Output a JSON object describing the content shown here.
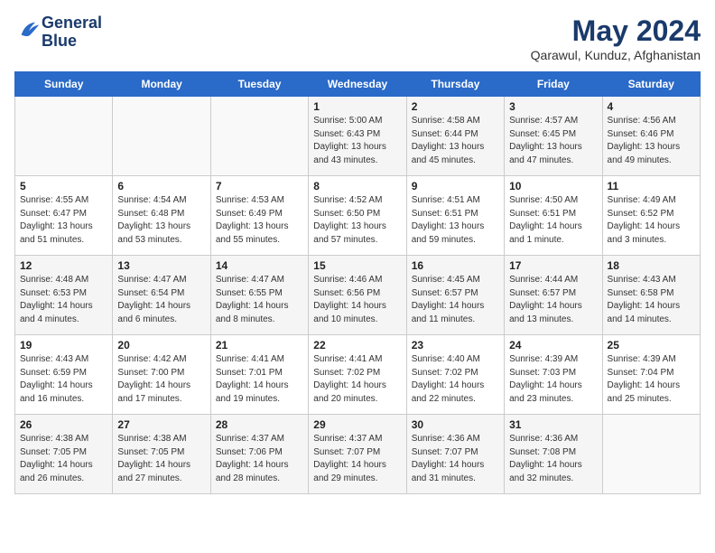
{
  "header": {
    "logo_line1": "General",
    "logo_line2": "Blue",
    "month": "May 2024",
    "location": "Qarawul, Kunduz, Afghanistan"
  },
  "weekdays": [
    "Sunday",
    "Monday",
    "Tuesday",
    "Wednesday",
    "Thursday",
    "Friday",
    "Saturday"
  ],
  "weeks": [
    [
      {
        "day": "",
        "info": ""
      },
      {
        "day": "",
        "info": ""
      },
      {
        "day": "",
        "info": ""
      },
      {
        "day": "1",
        "info": "Sunrise: 5:00 AM\nSunset: 6:43 PM\nDaylight: 13 hours\nand 43 minutes."
      },
      {
        "day": "2",
        "info": "Sunrise: 4:58 AM\nSunset: 6:44 PM\nDaylight: 13 hours\nand 45 minutes."
      },
      {
        "day": "3",
        "info": "Sunrise: 4:57 AM\nSunset: 6:45 PM\nDaylight: 13 hours\nand 47 minutes."
      },
      {
        "day": "4",
        "info": "Sunrise: 4:56 AM\nSunset: 6:46 PM\nDaylight: 13 hours\nand 49 minutes."
      }
    ],
    [
      {
        "day": "5",
        "info": "Sunrise: 4:55 AM\nSunset: 6:47 PM\nDaylight: 13 hours\nand 51 minutes."
      },
      {
        "day": "6",
        "info": "Sunrise: 4:54 AM\nSunset: 6:48 PM\nDaylight: 13 hours\nand 53 minutes."
      },
      {
        "day": "7",
        "info": "Sunrise: 4:53 AM\nSunset: 6:49 PM\nDaylight: 13 hours\nand 55 minutes."
      },
      {
        "day": "8",
        "info": "Sunrise: 4:52 AM\nSunset: 6:50 PM\nDaylight: 13 hours\nand 57 minutes."
      },
      {
        "day": "9",
        "info": "Sunrise: 4:51 AM\nSunset: 6:51 PM\nDaylight: 13 hours\nand 59 minutes."
      },
      {
        "day": "10",
        "info": "Sunrise: 4:50 AM\nSunset: 6:51 PM\nDaylight: 14 hours\nand 1 minute."
      },
      {
        "day": "11",
        "info": "Sunrise: 4:49 AM\nSunset: 6:52 PM\nDaylight: 14 hours\nand 3 minutes."
      }
    ],
    [
      {
        "day": "12",
        "info": "Sunrise: 4:48 AM\nSunset: 6:53 PM\nDaylight: 14 hours\nand 4 minutes."
      },
      {
        "day": "13",
        "info": "Sunrise: 4:47 AM\nSunset: 6:54 PM\nDaylight: 14 hours\nand 6 minutes."
      },
      {
        "day": "14",
        "info": "Sunrise: 4:47 AM\nSunset: 6:55 PM\nDaylight: 14 hours\nand 8 minutes."
      },
      {
        "day": "15",
        "info": "Sunrise: 4:46 AM\nSunset: 6:56 PM\nDaylight: 14 hours\nand 10 minutes."
      },
      {
        "day": "16",
        "info": "Sunrise: 4:45 AM\nSunset: 6:57 PM\nDaylight: 14 hours\nand 11 minutes."
      },
      {
        "day": "17",
        "info": "Sunrise: 4:44 AM\nSunset: 6:57 PM\nDaylight: 14 hours\nand 13 minutes."
      },
      {
        "day": "18",
        "info": "Sunrise: 4:43 AM\nSunset: 6:58 PM\nDaylight: 14 hours\nand 14 minutes."
      }
    ],
    [
      {
        "day": "19",
        "info": "Sunrise: 4:43 AM\nSunset: 6:59 PM\nDaylight: 14 hours\nand 16 minutes."
      },
      {
        "day": "20",
        "info": "Sunrise: 4:42 AM\nSunset: 7:00 PM\nDaylight: 14 hours\nand 17 minutes."
      },
      {
        "day": "21",
        "info": "Sunrise: 4:41 AM\nSunset: 7:01 PM\nDaylight: 14 hours\nand 19 minutes."
      },
      {
        "day": "22",
        "info": "Sunrise: 4:41 AM\nSunset: 7:02 PM\nDaylight: 14 hours\nand 20 minutes."
      },
      {
        "day": "23",
        "info": "Sunrise: 4:40 AM\nSunset: 7:02 PM\nDaylight: 14 hours\nand 22 minutes."
      },
      {
        "day": "24",
        "info": "Sunrise: 4:39 AM\nSunset: 7:03 PM\nDaylight: 14 hours\nand 23 minutes."
      },
      {
        "day": "25",
        "info": "Sunrise: 4:39 AM\nSunset: 7:04 PM\nDaylight: 14 hours\nand 25 minutes."
      }
    ],
    [
      {
        "day": "26",
        "info": "Sunrise: 4:38 AM\nSunset: 7:05 PM\nDaylight: 14 hours\nand 26 minutes."
      },
      {
        "day": "27",
        "info": "Sunrise: 4:38 AM\nSunset: 7:05 PM\nDaylight: 14 hours\nand 27 minutes."
      },
      {
        "day": "28",
        "info": "Sunrise: 4:37 AM\nSunset: 7:06 PM\nDaylight: 14 hours\nand 28 minutes."
      },
      {
        "day": "29",
        "info": "Sunrise: 4:37 AM\nSunset: 7:07 PM\nDaylight: 14 hours\nand 29 minutes."
      },
      {
        "day": "30",
        "info": "Sunrise: 4:36 AM\nSunset: 7:07 PM\nDaylight: 14 hours\nand 31 minutes."
      },
      {
        "day": "31",
        "info": "Sunrise: 4:36 AM\nSunset: 7:08 PM\nDaylight: 14 hours\nand 32 minutes."
      },
      {
        "day": "",
        "info": ""
      }
    ]
  ]
}
